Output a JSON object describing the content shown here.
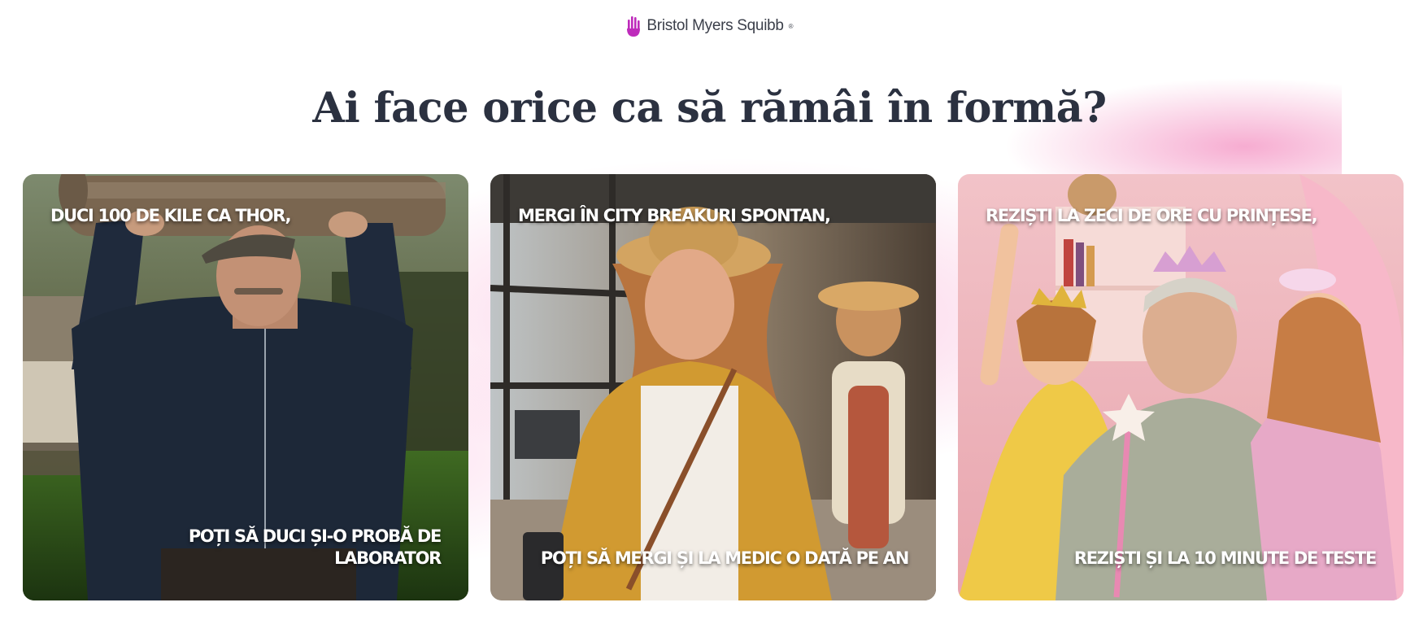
{
  "header": {
    "logo_text": "Bristol Myers Squibb",
    "logo_mark": "hand-icon",
    "brand_color": "#be2bbb"
  },
  "headline": "Ai face orice ca să rămâi în formă?",
  "cards": [
    {
      "top_text": "DUCI 100 DE KILE CA THOR,",
      "bottom_text": "POȚI SĂ DUCI ȘI-O PROBĂ DE LABORATOR"
    },
    {
      "top_text": "MERGI ÎN CITY BREAKURI SPONTAN,",
      "bottom_text": "POȚI SĂ MERGI ȘI LA MEDIC O DATĂ PE AN"
    },
    {
      "top_text": "REZIȘTI LA ZECI DE ORE CU PRINȚESE,",
      "bottom_text": "REZIȘTI ȘI LA 10 MINUTE DE TESTE"
    }
  ],
  "colors": {
    "headline": "#2b3140",
    "glow": "#ec4899"
  }
}
